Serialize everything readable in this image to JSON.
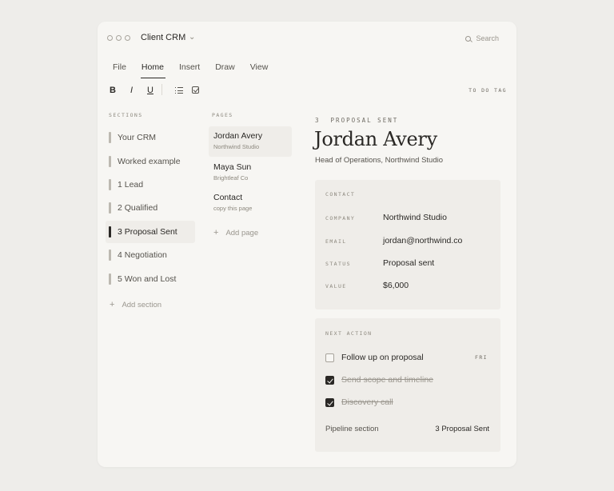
{
  "window": {
    "title": "Client CRM",
    "search_placeholder": "Search"
  },
  "menu": {
    "tabs": [
      {
        "label": "File",
        "active": false
      },
      {
        "label": "Home",
        "active": true
      },
      {
        "label": "Insert",
        "active": false
      },
      {
        "label": "Draw",
        "active": false
      },
      {
        "label": "View",
        "active": false
      }
    ]
  },
  "toolbar": {
    "bold": "B",
    "italic": "I",
    "underline": "U",
    "todo_tag": "TO DO TAG"
  },
  "sections": {
    "header": "SECTIONS",
    "items": [
      {
        "label": "Your CRM",
        "active": false
      },
      {
        "label": "Worked example",
        "active": false
      },
      {
        "label": "1 Lead",
        "active": false
      },
      {
        "label": "2 Qualified",
        "active": false
      },
      {
        "label": "3 Proposal Sent",
        "active": true
      },
      {
        "label": "4 Negotiation",
        "active": false
      },
      {
        "label": "5 Won and Lost",
        "active": false
      }
    ],
    "add_label": "Add section"
  },
  "pages": {
    "header": "PAGES",
    "items": [
      {
        "title": "Jordan Avery",
        "subtitle": "Northwind Studio",
        "active": true
      },
      {
        "title": "Maya Sun",
        "subtitle": "Brightleaf Co",
        "active": false
      },
      {
        "title": "Contact",
        "subtitle": "copy this page",
        "active": false
      }
    ],
    "add_label": "Add page"
  },
  "detail": {
    "eyebrow": "3  PROPOSAL SENT",
    "name": "Jordan Avery",
    "subtitle": "Head of Operations, Northwind Studio",
    "contact": {
      "title": "CONTACT",
      "rows": [
        {
          "key": "COMPANY",
          "value": "Northwind Studio"
        },
        {
          "key": "EMAIL",
          "value": "jordan@northwind.co"
        },
        {
          "key": "STATUS",
          "value": "Proposal sent"
        },
        {
          "key": "VALUE",
          "value": "$6,000"
        }
      ]
    },
    "next_action": {
      "title": "NEXT ACTION",
      "tasks": [
        {
          "label": "Follow up on proposal",
          "done": false,
          "due": "FRI"
        },
        {
          "label": "Send scope and timeline",
          "done": true,
          "due": ""
        },
        {
          "label": "Discovery call",
          "done": true,
          "due": ""
        }
      ],
      "pipeline_label": "Pipeline section",
      "pipeline_value": "3 Proposal Sent"
    }
  },
  "icons": {
    "window_controls": "circle-outline-icon",
    "dropdown": "chevron-down-icon",
    "search": "search-icon",
    "bullet_list": "bullet-list-icon",
    "checkbox": "checkbox-icon",
    "add": "plus-icon"
  },
  "colors": {
    "background": "#eeedea",
    "window": "#f7f6f3",
    "card": "#efede9",
    "ink": "#2a2825",
    "muted": "#8d897f"
  }
}
